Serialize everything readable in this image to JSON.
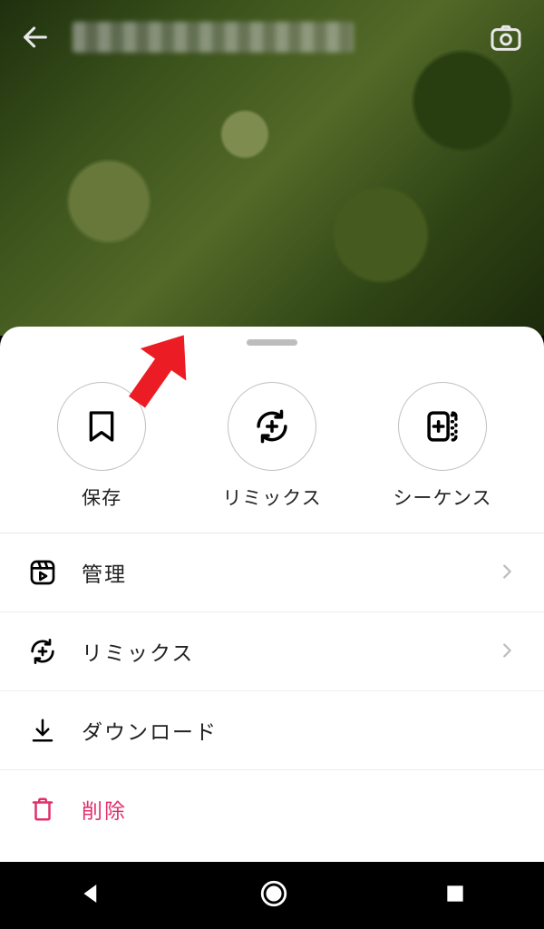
{
  "sheet": {
    "circles": {
      "save": "保存",
      "remix": "リミックス",
      "sequence": "シーケンス"
    },
    "menu": {
      "manage": "管理",
      "remix": "リミックス",
      "download": "ダウンロード",
      "delete": "削除"
    }
  }
}
